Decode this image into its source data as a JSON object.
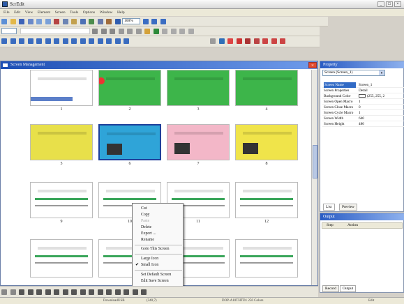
{
  "app": {
    "title": "ScrEdit"
  },
  "menu": [
    "File",
    "Edit",
    "View",
    "Element",
    "Screen",
    "Tools",
    "Options",
    "Window",
    "Help"
  ],
  "toolbar": {
    "zoom": "100%"
  },
  "screen_mgmt": {
    "title": "Screen Management",
    "thumbnails": [
      {
        "num": "1",
        "bg": "#ffffff"
      },
      {
        "num": "2",
        "bg": "#3db54a"
      },
      {
        "num": "3",
        "bg": "#3db54a"
      },
      {
        "num": "4",
        "bg": "#3db54a"
      },
      {
        "num": "5",
        "bg": "#e8e04a"
      },
      {
        "num": "6",
        "bg": "#2fa4d8"
      },
      {
        "num": "7",
        "bg": "#f3b7c8"
      },
      {
        "num": "8",
        "bg": "#f0e44a"
      },
      {
        "num": "9",
        "bg": "#ffffff"
      },
      {
        "num": "10",
        "bg": "#ffffff"
      },
      {
        "num": "11",
        "bg": "#ffffff"
      },
      {
        "num": "12",
        "bg": "#ffffff"
      },
      {
        "num": "",
        "bg": "#ffffff"
      },
      {
        "num": "",
        "bg": "#ffffff"
      },
      {
        "num": "",
        "bg": "#ffffff"
      },
      {
        "num": "",
        "bg": "#ffffff"
      }
    ]
  },
  "context_menu": {
    "items": [
      "Cut",
      "Copy",
      "Paste",
      "Delete",
      "Export ...",
      "Rename",
      "Goto This Screen",
      "Large Icon",
      "Small Icon",
      "Set Default Screen",
      "Edit Save Screen"
    ],
    "checked": "Small Icon"
  },
  "property": {
    "title": "Property",
    "selector": "Screen (Screen_1)",
    "rows": [
      {
        "key": "Screen Name",
        "val": "Screen_1"
      },
      {
        "key": "Screen Properties",
        "val": "Detail"
      },
      {
        "key": "Background Color",
        "val": "(255, 255, 2"
      },
      {
        "key": "Screen Open Macro",
        "val": "1"
      },
      {
        "key": "Screen Close Macro",
        "val": "0"
      },
      {
        "key": "Screen Cycle Macro",
        "val": "1"
      },
      {
        "key": "Screen Width",
        "val": "640"
      },
      {
        "key": "Screen Height",
        "val": "480"
      }
    ],
    "tabs": [
      "List",
      "Preview"
    ]
  },
  "output": {
    "title": "Output",
    "columns": [
      "Step",
      "Action"
    ],
    "tabs": [
      "Record",
      "Output"
    ]
  },
  "status": [
    "DownloadUSB",
    "(340,7)",
    "DOP-A10THTD1 256 Colors",
    "Edit"
  ],
  "colors": {
    "accent": "#1e4fb5",
    "close": "#e24a2e",
    "panel": "#d4d0c8"
  }
}
